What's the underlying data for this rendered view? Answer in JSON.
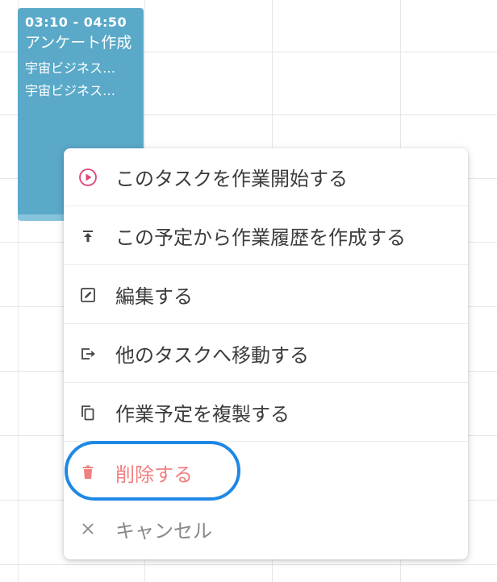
{
  "event": {
    "time": "03:10 - 04:50",
    "title": "アンケート作成",
    "lines": [
      "宇宙ビジネス…",
      "宇宙ビジネス…"
    ],
    "color": "#5aa9c9"
  },
  "menu": {
    "items": [
      {
        "label": "このタスクを作業開始する",
        "icon": "play-circle-icon"
      },
      {
        "label": "この予定から作業履歴を作成する",
        "icon": "upload-icon"
      },
      {
        "label": "編集する",
        "icon": "edit-icon"
      },
      {
        "label": "他のタスクへ移動する",
        "icon": "move-icon"
      },
      {
        "label": "作業予定を複製する",
        "icon": "copy-icon"
      },
      {
        "label": "削除する",
        "icon": "trash-icon"
      },
      {
        "label": "キャンセル",
        "icon": "close-icon"
      }
    ]
  },
  "colors": {
    "accent_play": "#e0457b",
    "delete": "#f08080",
    "highlight": "#1e88e5"
  }
}
